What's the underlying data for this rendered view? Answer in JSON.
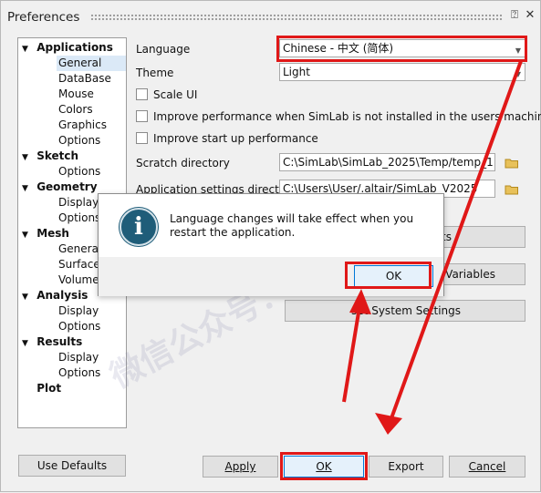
{
  "window": {
    "title": "Preferences"
  },
  "tree": {
    "items": [
      {
        "label": "Applications",
        "level": 0,
        "expanded": true
      },
      {
        "label": "General",
        "level": 1,
        "selected": true
      },
      {
        "label": "DataBase",
        "level": 1
      },
      {
        "label": "Mouse",
        "level": 1
      },
      {
        "label": "Colors",
        "level": 1
      },
      {
        "label": "Graphics",
        "level": 1
      },
      {
        "label": "Options",
        "level": 1
      },
      {
        "label": "Sketch",
        "level": 0,
        "expanded": true
      },
      {
        "label": "Options",
        "level": 1
      },
      {
        "label": "Geometry",
        "level": 0,
        "expanded": true
      },
      {
        "label": "Display",
        "level": 1
      },
      {
        "label": "Options",
        "level": 1
      },
      {
        "label": "Mesh",
        "level": 0,
        "expanded": true
      },
      {
        "label": "General",
        "level": 1
      },
      {
        "label": "Surface",
        "level": 1
      },
      {
        "label": "Volume",
        "level": 1
      },
      {
        "label": "Analysis",
        "level": 0,
        "expanded": true
      },
      {
        "label": "Display",
        "level": 1
      },
      {
        "label": "Options",
        "level": 1
      },
      {
        "label": "Results",
        "level": 0,
        "expanded": true
      },
      {
        "label": "Display",
        "level": 1
      },
      {
        "label": "Options",
        "level": 1
      },
      {
        "label": "Plot",
        "level": 0,
        "expanded": false
      }
    ]
  },
  "general": {
    "language_label": "Language",
    "language_value": "Chinese - 中文 (简体)",
    "theme_label": "Theme",
    "theme_value": "Light",
    "scale_ui_label": "Scale UI",
    "improve_perf_label": "Improve performance when SimLab is not installed in the users machine",
    "improve_startup_label": "Improve start up performance",
    "scratch_label": "Scratch directory",
    "scratch_value": "C:\\SimLab\\SimLab_2025\\Temp/temp_1",
    "appsettings_label": "Application settings directory",
    "appsettings_value": "C:\\Users\\User/.altair/SimLab_V2025",
    "btn_shortcuts_partial": "ts",
    "btn_env_partial": "t Variables",
    "btn_reset_partial": "set System Settings"
  },
  "footer": {
    "use_defaults": "Use Defaults",
    "apply": "Apply",
    "ok": "OK",
    "export": "Export",
    "cancel": "Cancel"
  },
  "dialog": {
    "message": "Language changes will take effect when you restart the application.",
    "ok": "OK"
  },
  "annotations": {
    "highlight_color": "#e01818"
  }
}
